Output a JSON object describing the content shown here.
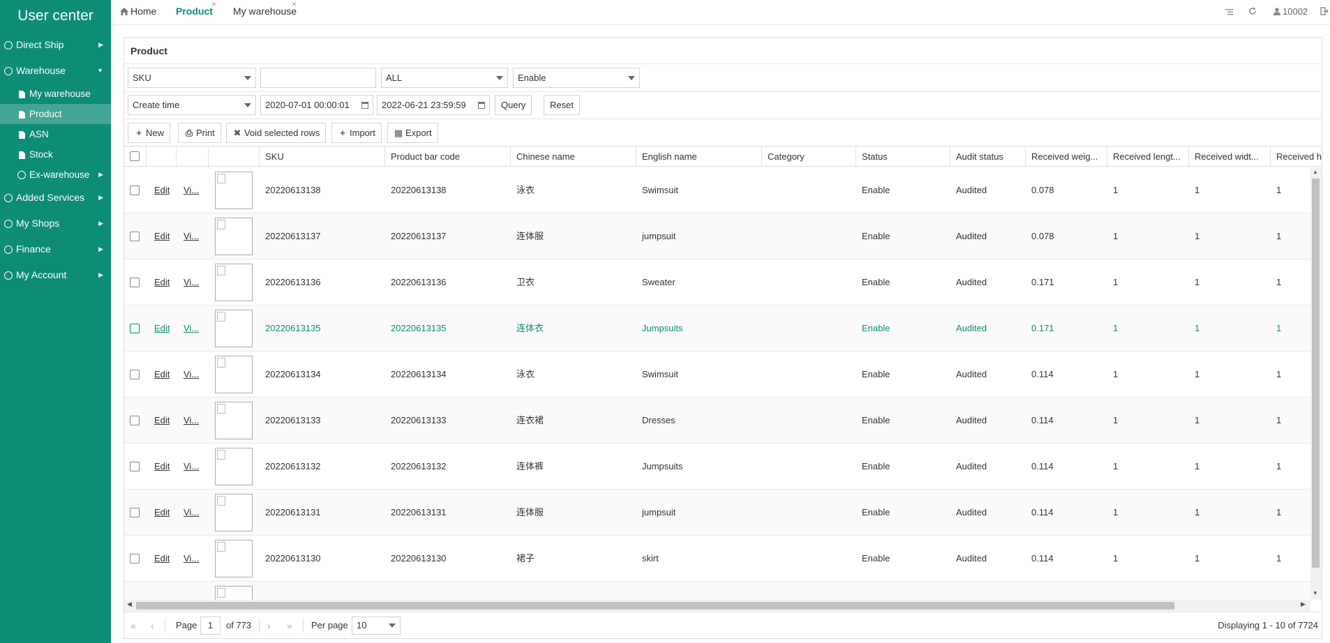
{
  "sidebar": {
    "title": "User center",
    "items": [
      {
        "label": "Direct Ship"
      },
      {
        "label": "Warehouse"
      },
      {
        "label": "Added Services"
      },
      {
        "label": "My Shops"
      },
      {
        "label": "Finance"
      },
      {
        "label": "My Account"
      }
    ],
    "warehouse_sub": [
      {
        "label": "My warehouse"
      },
      {
        "label": "Product"
      },
      {
        "label": "ASN"
      },
      {
        "label": "Stock"
      },
      {
        "label": "Ex-warehouse"
      }
    ]
  },
  "topbar": {
    "tabs": [
      {
        "label": "Home"
      },
      {
        "label": "Product"
      },
      {
        "label": "My warehouse"
      }
    ],
    "user_id": "10002",
    "close_glyph": "×"
  },
  "panel": {
    "title": "Product",
    "filters": {
      "field_select": "SKU",
      "search_value": "",
      "type_select": "ALL",
      "status_select": "Enable",
      "time_select": "Create time",
      "date_from": "2020-07-01 00:00:01",
      "date_to": "2022-06-21 23:59:59",
      "query_label": "Query",
      "reset_label": "Reset"
    },
    "toolbar": {
      "new_label": "New",
      "print_label": "Print",
      "void_label": "Void selected rows",
      "import_label": "Import",
      "export_label": "Export"
    }
  },
  "table": {
    "columns": [
      "SKU",
      "Product bar code",
      "Chinese name",
      "English name",
      "Category",
      "Status",
      "Audit status",
      "Received weig...",
      "Received lengt...",
      "Received widt...",
      "Received h"
    ],
    "edit_label": "Edit",
    "view_label": "Vi...",
    "rows": [
      {
        "sku": "20220613138",
        "barcode": "20220613138",
        "cn": "泳衣",
        "en": "Swimsuit",
        "category": "",
        "status": "Enable",
        "audit": "Audited",
        "weight": "0.078",
        "length": "1",
        "width": "1",
        "height": "1"
      },
      {
        "sku": "20220613137",
        "barcode": "20220613137",
        "cn": "连体服",
        "en": "jumpsuit",
        "category": "",
        "status": "Enable",
        "audit": "Audited",
        "weight": "0.078",
        "length": "1",
        "width": "1",
        "height": "1"
      },
      {
        "sku": "20220613136",
        "barcode": "20220613136",
        "cn": "卫衣",
        "en": "Sweater",
        "category": "",
        "status": "Enable",
        "audit": "Audited",
        "weight": "0.171",
        "length": "1",
        "width": "1",
        "height": "1"
      },
      {
        "sku": "20220613135",
        "barcode": "20220613135",
        "cn": "连体衣",
        "en": "Jumpsuits",
        "category": "",
        "status": "Enable",
        "audit": "Audited",
        "weight": "0.171",
        "length": "1",
        "width": "1",
        "height": "1"
      },
      {
        "sku": "20220613134",
        "barcode": "20220613134",
        "cn": "泳衣",
        "en": "Swimsuit",
        "category": "",
        "status": "Enable",
        "audit": "Audited",
        "weight": "0.114",
        "length": "1",
        "width": "1",
        "height": "1"
      },
      {
        "sku": "20220613133",
        "barcode": "20220613133",
        "cn": "连衣裙",
        "en": "Dresses",
        "category": "",
        "status": "Enable",
        "audit": "Audited",
        "weight": "0.114",
        "length": "1",
        "width": "1",
        "height": "1"
      },
      {
        "sku": "20220613132",
        "barcode": "20220613132",
        "cn": "连体裤",
        "en": "Jumpsuits",
        "category": "",
        "status": "Enable",
        "audit": "Audited",
        "weight": "0.114",
        "length": "1",
        "width": "1",
        "height": "1"
      },
      {
        "sku": "20220613131",
        "barcode": "20220613131",
        "cn": "连体服",
        "en": "jumpsuit",
        "category": "",
        "status": "Enable",
        "audit": "Audited",
        "weight": "0.114",
        "length": "1",
        "width": "1",
        "height": "1"
      },
      {
        "sku": "20220613130",
        "barcode": "20220613130",
        "cn": "裙子",
        "en": "skirt",
        "category": "",
        "status": "Enable",
        "audit": "Audited",
        "weight": "0.114",
        "length": "1",
        "width": "1",
        "height": "1"
      }
    ]
  },
  "pager": {
    "page_label": "Page",
    "page_value": "1",
    "of_label": "of 773",
    "per_page_label": "Per page",
    "per_page_value": "10",
    "display_text": "Displaying 1 - 10 of 7724"
  },
  "colors": {
    "sidebar_bg": "#0d8c76",
    "sidebar_active": "#43a593",
    "accent": "#0d8c76"
  },
  "icons": {
    "home": "home-icon",
    "user": "user-icon",
    "refresh": "refresh-icon",
    "menu": "list-icon",
    "logout": "logout-icon"
  }
}
